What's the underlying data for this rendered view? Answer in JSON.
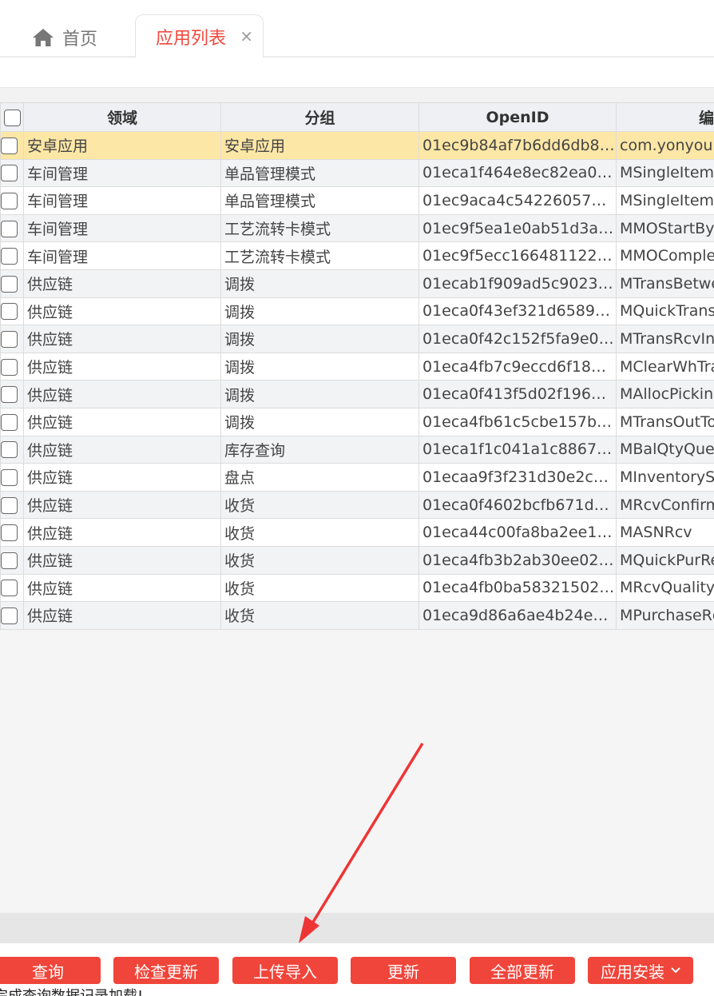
{
  "tabs": {
    "home_label": "首页",
    "active_label": "应用列表",
    "close_glyph": "×"
  },
  "table": {
    "columns": [
      "领域",
      "分组",
      "OpenID",
      "编"
    ],
    "rows": [
      {
        "domain": "安卓应用",
        "group": "安卓应用",
        "openid": "01ec9b84af7b6dd6db82f…",
        "code": "com.yonyou.u"
      },
      {
        "domain": "车间管理",
        "group": "单品管理模式",
        "openid": "01eca1f464e8ec82ea02f…",
        "code": "MSingleItemC"
      },
      {
        "domain": "车间管理",
        "group": "单品管理模式",
        "openid": "01ec9aca4c5422605750…",
        "code": "MSingleItemS"
      },
      {
        "domain": "车间管理",
        "group": "工艺流转卡模式",
        "openid": "01ec9f5ea1e0ab51d3acf…",
        "code": "MMOStartByD"
      },
      {
        "domain": "车间管理",
        "group": "工艺流转卡模式",
        "openid": "01ec9f5ecc166481122cf…",
        "code": "MMOComplet"
      },
      {
        "domain": "供应链",
        "group": "调拨",
        "openid": "01ecab1f909ad5c90236f…",
        "code": "MTransBetwe"
      },
      {
        "domain": "供应链",
        "group": "调拨",
        "openid": "01eca0f43ef321d65893f…",
        "code": "MQuickTransI"
      },
      {
        "domain": "供应链",
        "group": "调拨",
        "openid": "01eca0f42c152f5fa9e0fa…",
        "code": "MTransRcvIn"
      },
      {
        "domain": "供应链",
        "group": "调拨",
        "openid": "01eca4fb7c9eccd6f184f…",
        "code": "MClearWhTra"
      },
      {
        "domain": "供应链",
        "group": "调拨",
        "openid": "01eca0f413f5d02f1965fa…",
        "code": "MAllocPicking"
      },
      {
        "domain": "供应链",
        "group": "调拨",
        "openid": "01eca4fb61c5cbe157bef…",
        "code": "MTransOutTo"
      },
      {
        "domain": "供应链",
        "group": "库存查询",
        "openid": "01eca1f1c041a1c88672f…",
        "code": "MBalQtyQuer"
      },
      {
        "domain": "供应链",
        "group": "盘点",
        "openid": "01ecaa9f3f231d30e2c9f…",
        "code": "MInventorySh"
      },
      {
        "domain": "供应链",
        "group": "收货",
        "openid": "01eca0f4602bcfb671d8f…",
        "code": "MRcvConfirm"
      },
      {
        "domain": "供应链",
        "group": "收货",
        "openid": "01eca44c00fa8ba2ee11f…",
        "code": "MASNRcv"
      },
      {
        "domain": "供应链",
        "group": "收货",
        "openid": "01eca4fb3b2ab30ee027f…",
        "code": "MQuickPurRe"
      },
      {
        "domain": "供应链",
        "group": "收货",
        "openid": "01eca4fb0ba583215026f…",
        "code": "MRcvQualityC"
      },
      {
        "domain": "供应链",
        "group": "收货",
        "openid": "01eca9d86a6ae4b24e75…",
        "code": "MPurchaseRc"
      }
    ]
  },
  "buttons": {
    "query": "查询",
    "check_update": "检查更新",
    "upload_import": "上传导入",
    "update": "更新",
    "update_all": "全部更新",
    "app_install": "应用安装"
  },
  "status_text": "完成查询数据记录加载!",
  "colors": {
    "accent": "#f0453a",
    "active_tab_text": "#f0493d",
    "selected_row": "#fde7a6",
    "arrow": "#ee3535"
  }
}
